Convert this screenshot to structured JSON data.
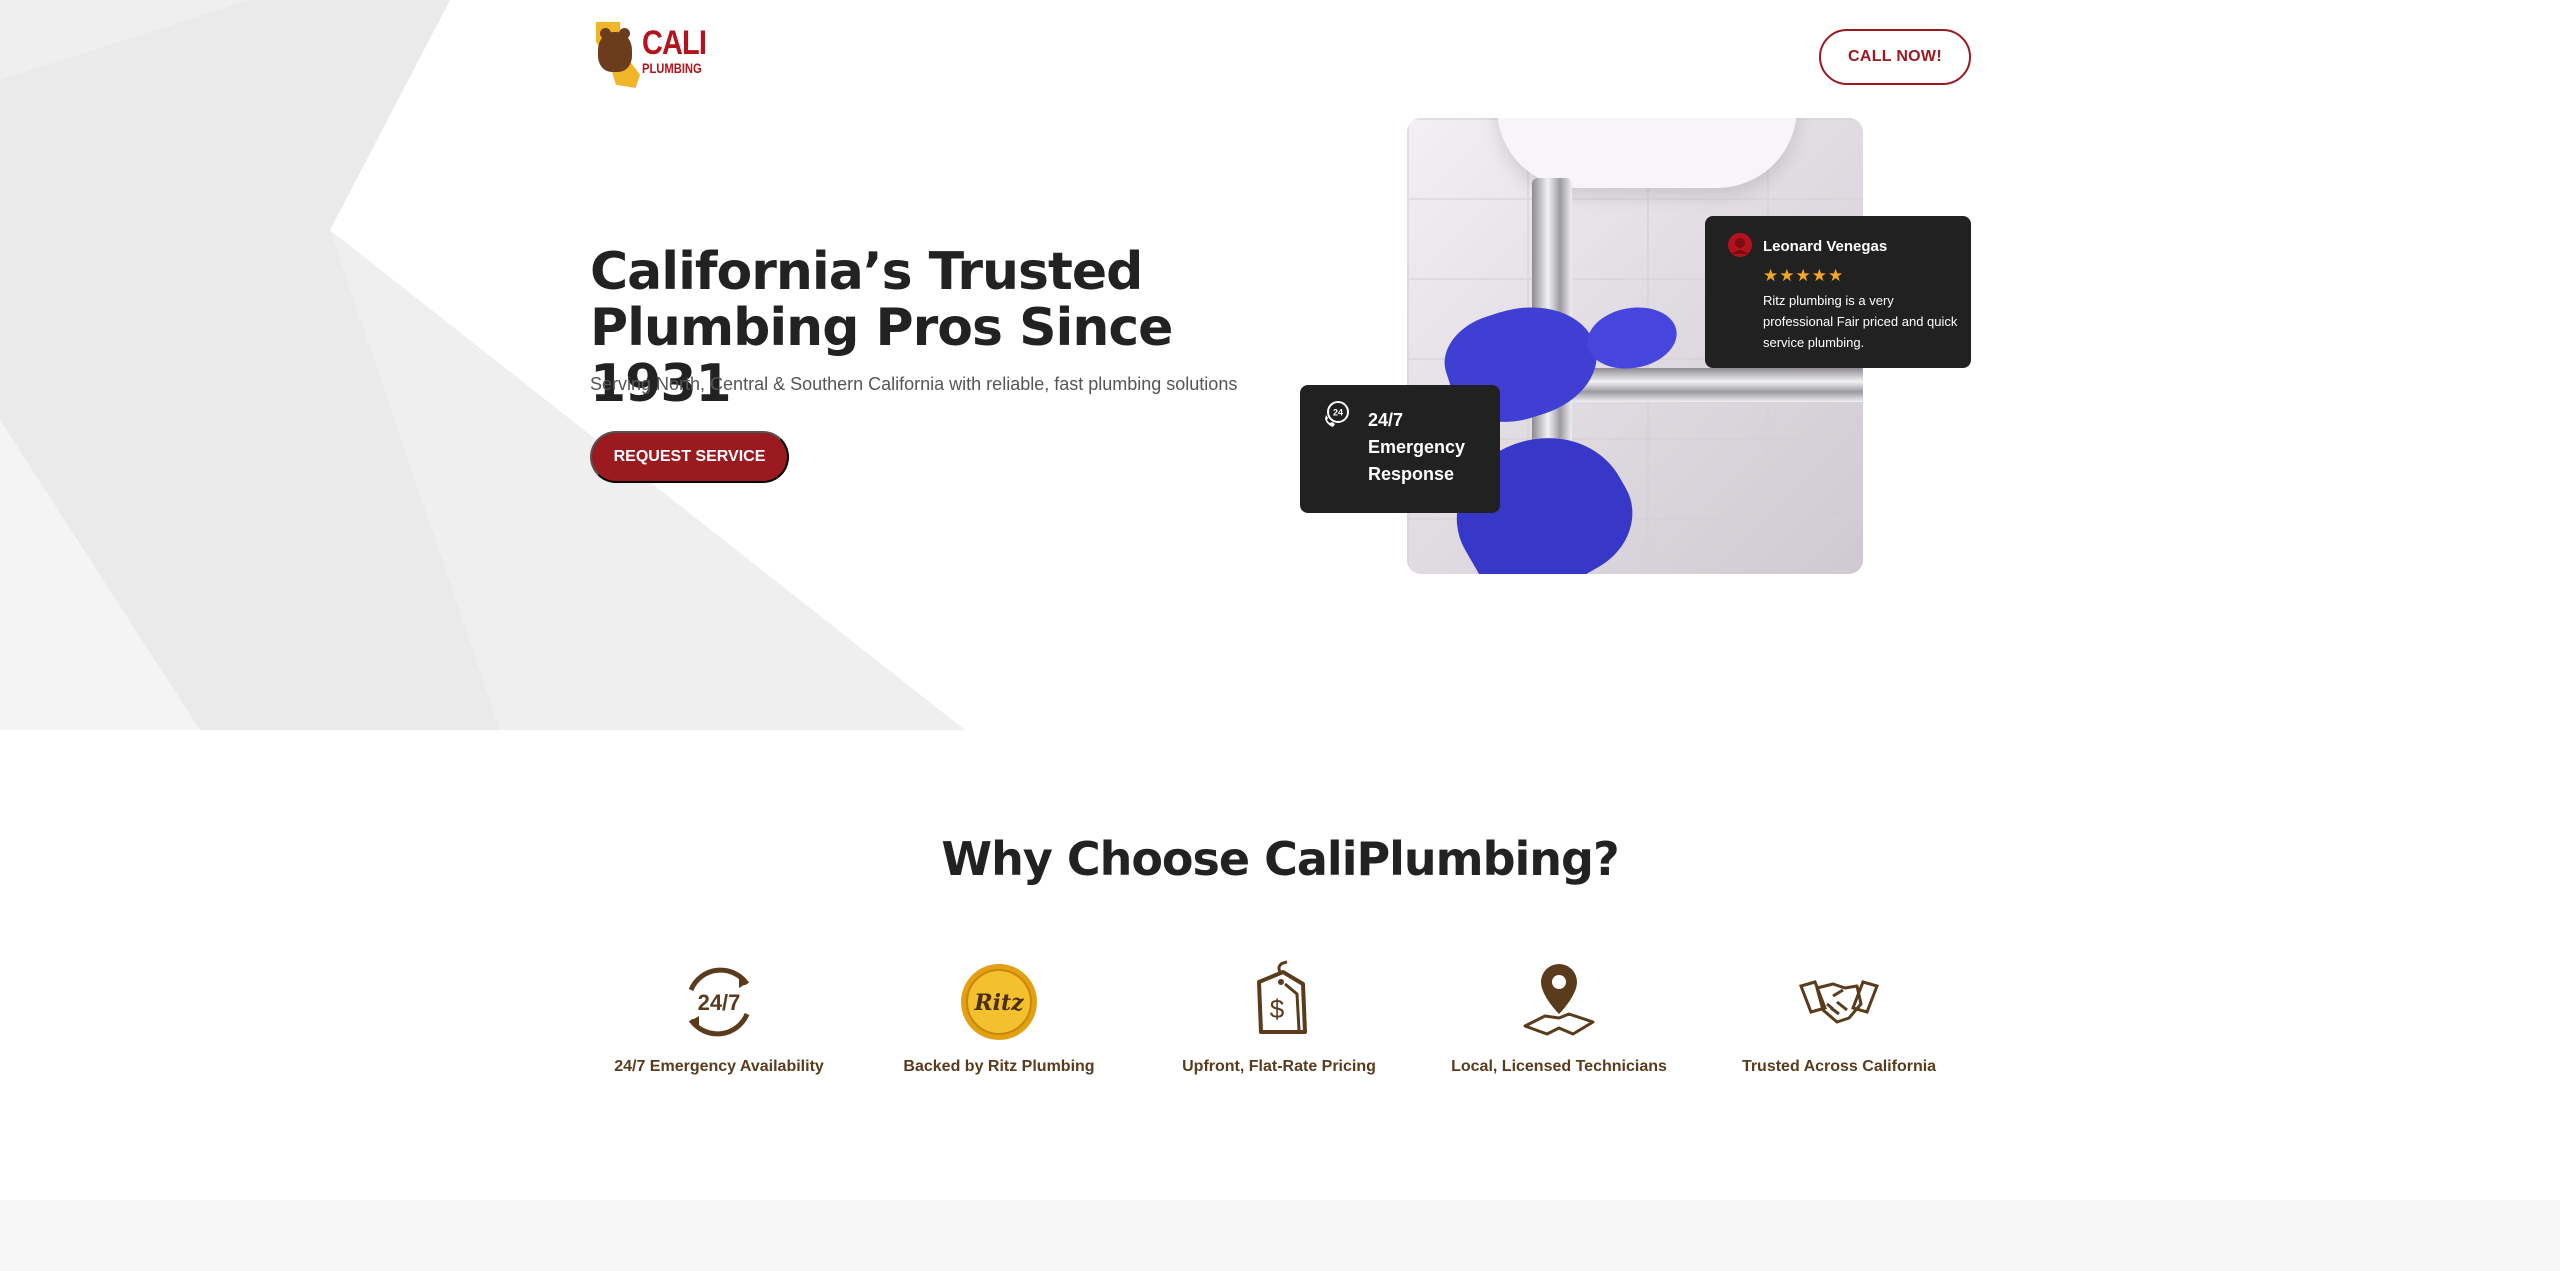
{
  "header": {
    "logo_text_main": "CALI",
    "logo_text_sub": "PLUMBING",
    "call_label": "CALL NOW!"
  },
  "hero": {
    "title_line1": "California’s Trusted",
    "title_line2": "Plumbing Pros Since 1931",
    "subtitle": "Serving North, Central & Southern California with reliable, fast plumbing solutions",
    "cta_label": "REQUEST SERVICE",
    "photo_icon": "plumber-photo"
  },
  "review": {
    "name": "Leonard Venegas",
    "stars": "★★★★★",
    "rating": 5,
    "text": "Ritz plumbing is a very professional Fair priced and quick service plumbing.",
    "icon": "reviewer-avatar-icon"
  },
  "emergency": {
    "line1": "24/7",
    "line2": "Emergency",
    "line3": "Response",
    "icon": "phone-24-icon"
  },
  "why": {
    "title": "Why Choose CaliPlumbing?",
    "features": [
      {
        "label": "24/7 Emergency Availability",
        "icon": "clock-24-7-icon"
      },
      {
        "label": "Backed by Ritz Plumbing",
        "icon": "ritz-badge-icon",
        "badge_text": "Ritz"
      },
      {
        "label": "Upfront, Flat-Rate Pricing",
        "icon": "price-tag-icon"
      },
      {
        "label": "Local, Licensed Technicians",
        "icon": "map-pin-hand-icon"
      },
      {
        "label": "Trusted Across California",
        "icon": "handshake-icon"
      }
    ]
  },
  "colors": {
    "brand_red": "#9a1a20",
    "dark_card": "#212121",
    "feature_brown": "#5a3b1c",
    "star": "#f5a623"
  }
}
